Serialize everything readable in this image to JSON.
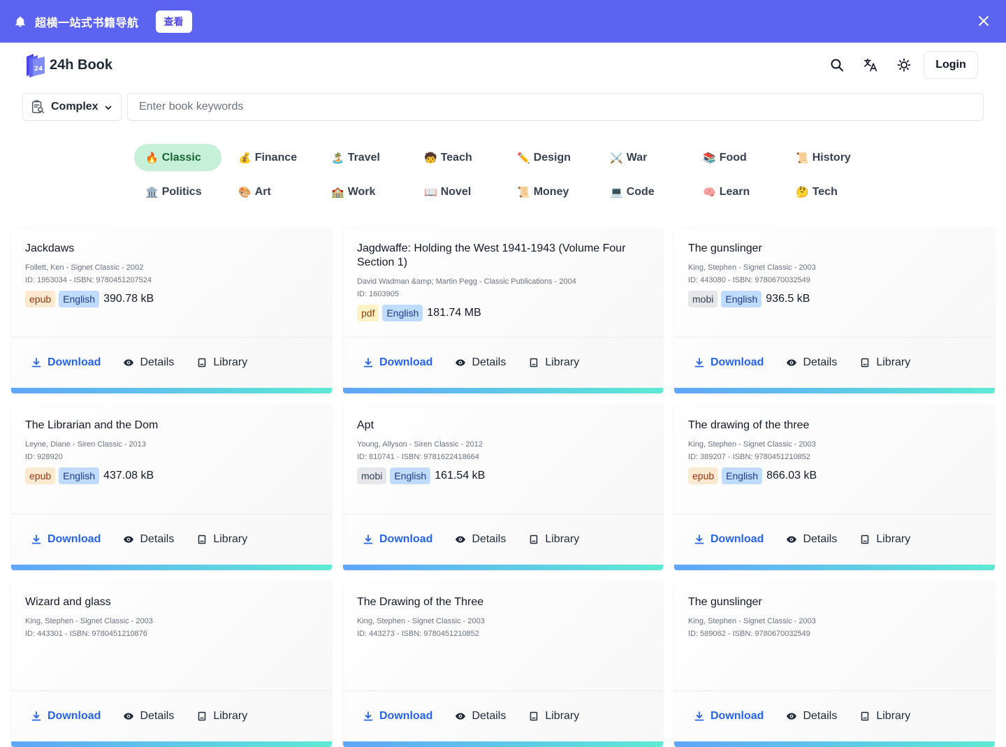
{
  "banner": {
    "text": "超横一站式书籍导航",
    "button": "查看"
  },
  "header": {
    "brand": "24h Book",
    "login": "Login"
  },
  "search": {
    "mode": "Complex",
    "placeholder": "Enter book keywords"
  },
  "categories": [
    {
      "emoji": "🔥",
      "label": "Classic",
      "active": true
    },
    {
      "emoji": "💰",
      "label": "Finance"
    },
    {
      "emoji": "🏝️",
      "label": "Travel"
    },
    {
      "emoji": "🧒",
      "label": "Teach"
    },
    {
      "emoji": "✏️",
      "label": "Design"
    },
    {
      "emoji": "⚔️",
      "label": "War"
    },
    {
      "emoji": "📚",
      "label": "Food"
    },
    {
      "emoji": "📜",
      "label": "History"
    },
    {
      "emoji": "🏛️",
      "label": "Politics"
    },
    {
      "emoji": "🎨",
      "label": "Art"
    },
    {
      "emoji": "🏫",
      "label": "Work"
    },
    {
      "emoji": "📖",
      "label": "Novel"
    },
    {
      "emoji": "📜",
      "label": "Money"
    },
    {
      "emoji": "💻",
      "label": "Code"
    },
    {
      "emoji": "🧠",
      "label": "Learn"
    },
    {
      "emoji": "🤔",
      "label": "Tech"
    }
  ],
  "actions": {
    "download": "Download",
    "details": "Details",
    "library": "Library"
  },
  "books": [
    {
      "title": "Jackdaws",
      "meta": "Follett, Ken - Signet Classic - 2002",
      "ids": "ID: 1953034 - ISBN: 9780451207524",
      "format": "epub",
      "lang": "English",
      "size": "390.78 kB"
    },
    {
      "title": "Jagdwaffe: Holding the West 1941-1943 (Volume Four Section 1)",
      "meta": "David Wadman &amp; Martin Pegg - Classic Publications - 2004",
      "ids": "ID: 1603905",
      "format": "pdf",
      "lang": "English",
      "size": "181.74 MB"
    },
    {
      "title": "The gunslinger",
      "meta": "King, Stephen - Signet Classic - 2003",
      "ids": "ID: 443080 - ISBN: 9780670032549",
      "format": "mobi",
      "lang": "English",
      "size": "936.5 kB"
    },
    {
      "title": "The Librarian and the Dom",
      "meta": "Leyne, Diane - Siren Classic - 2013",
      "ids": "ID: 928920",
      "format": "epub",
      "lang": "English",
      "size": "437.08 kB"
    },
    {
      "title": "Apt",
      "meta": "Young, Allyson - Siren Classic - 2012",
      "ids": "ID: 810741 - ISBN: 9781622418664",
      "format": "mobi",
      "lang": "English",
      "size": "161.54 kB"
    },
    {
      "title": "The drawing of the three",
      "meta": "King, Stephen - Signet Classic - 2003",
      "ids": "ID: 389207 - ISBN: 9780451210852",
      "format": "epub",
      "lang": "English",
      "size": "866.03 kB"
    },
    {
      "title": "Wizard and glass",
      "meta": "King, Stephen - Signet Classic - 2003",
      "ids": "ID: 443301 - ISBN: 9780451210876",
      "format": "",
      "lang": "",
      "size": ""
    },
    {
      "title": "The Drawing of the Three",
      "meta": "King, Stephen - Signet Classic - 2003",
      "ids": "ID: 443273 - ISBN: 9780451210852",
      "format": "",
      "lang": "",
      "size": ""
    },
    {
      "title": "The gunslinger",
      "meta": "King, Stephen - Signet Classic - 2003",
      "ids": "ID: 589062 - ISBN: 9780670032549",
      "format": "",
      "lang": "",
      "size": ""
    }
  ]
}
